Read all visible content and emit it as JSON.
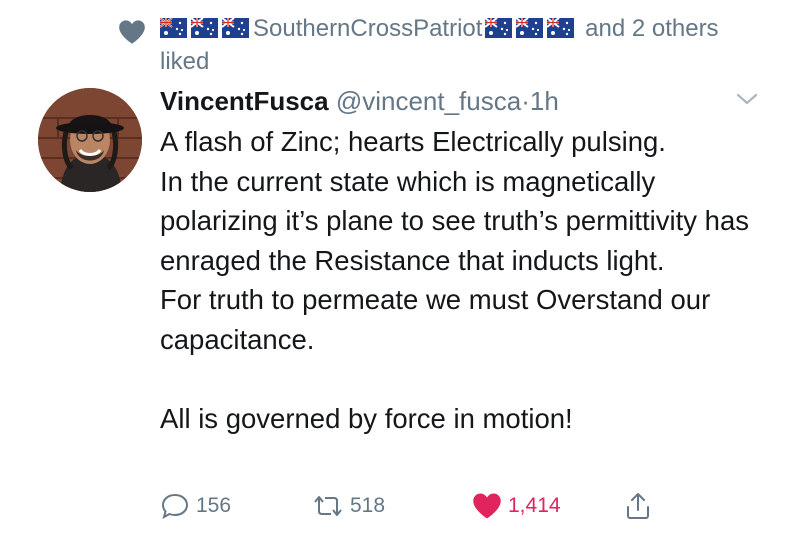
{
  "social_context": {
    "user": "SouthernCrossPatriot",
    "suffix": "and 2 others liked",
    "flag_icon": "australia-flag-icon",
    "heart_color": "#657786"
  },
  "tweet": {
    "display_name": "VincentFusca",
    "handle": "@vincent_fusca",
    "separator": "·",
    "time": "1h",
    "body": "A flash of Zinc; hearts Electrically pulsing.\nIn the current state which is magnetically polarizing it’s plane to see truth’s permittivity has enraged the Resistance that inducts light.\nFor truth to permeate we must Overstand our capacitance.\n\nAll is governed by force in motion!"
  },
  "actions": {
    "reply_count": "156",
    "retweet_count": "518",
    "like_count": "1,414",
    "like_color": "#e0245e"
  }
}
